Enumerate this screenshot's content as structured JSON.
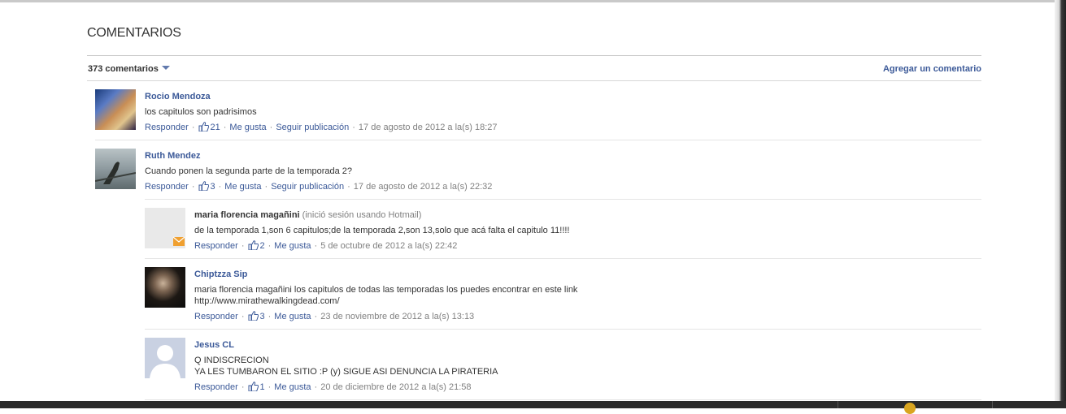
{
  "section": {
    "title": "COMENTARIOS",
    "count_label": "373 comentarios",
    "add_comment_label": "Agregar un comentario"
  },
  "comments": [
    {
      "author": "Rocio Mendoza",
      "text": "los capitulos son padrisimos",
      "reply": "Responder",
      "likes": "21",
      "like": "Me gusta",
      "follow": "Seguir publicación",
      "date": "17 de agosto de 2012 a la(s) 18:27"
    },
    {
      "author": "Ruth Mendez",
      "text": "Cuando ponen la segunda parte de la temporada 2?",
      "reply": "Responder",
      "likes": "3",
      "like": "Me gusta",
      "follow": "Seguir publicación",
      "date": "17 de agosto de 2012 a la(s) 22:32",
      "replies": [
        {
          "author": "maria florencia magañini",
          "note": "(inició sesión usando Hotmail)",
          "text": "de la temporada 1,son 6 capitulos;de la temporada 2,son 13,solo que acá falta el capitulo 11!!!!",
          "reply": "Responder",
          "likes": "2",
          "like": "Me gusta",
          "date": "5 de octubre de 2012 a la(s) 22:42"
        },
        {
          "author": "Chiptzza Sip",
          "text": "maria florencia magañini los capitulos de todas las temporadas los puedes encontrar en este link\nhttp://www.mirathewalkingdead.com/",
          "reply": "Responder",
          "likes": "3",
          "like": "Me gusta",
          "date": "23 de noviembre de 2012 a la(s) 13:13"
        },
        {
          "author": "Jesus CL",
          "text": "Q INDISCRECION\nYA LES TUMBARON EL SITIO :P (y) SIGUE ASI DENUNCIA LA PIRATERIA",
          "reply": "Responder",
          "likes": "1",
          "like": "Me gusta",
          "date": "20 de diciembre de 2012 a la(s) 21:58"
        }
      ]
    }
  ],
  "colors": {
    "link": "#3b5998",
    "muted": "#808080",
    "text": "#333333"
  },
  "icons": {
    "like": "thumbs-up-icon",
    "hotmail": "envelope-icon",
    "dropdown": "caret-down-icon"
  }
}
